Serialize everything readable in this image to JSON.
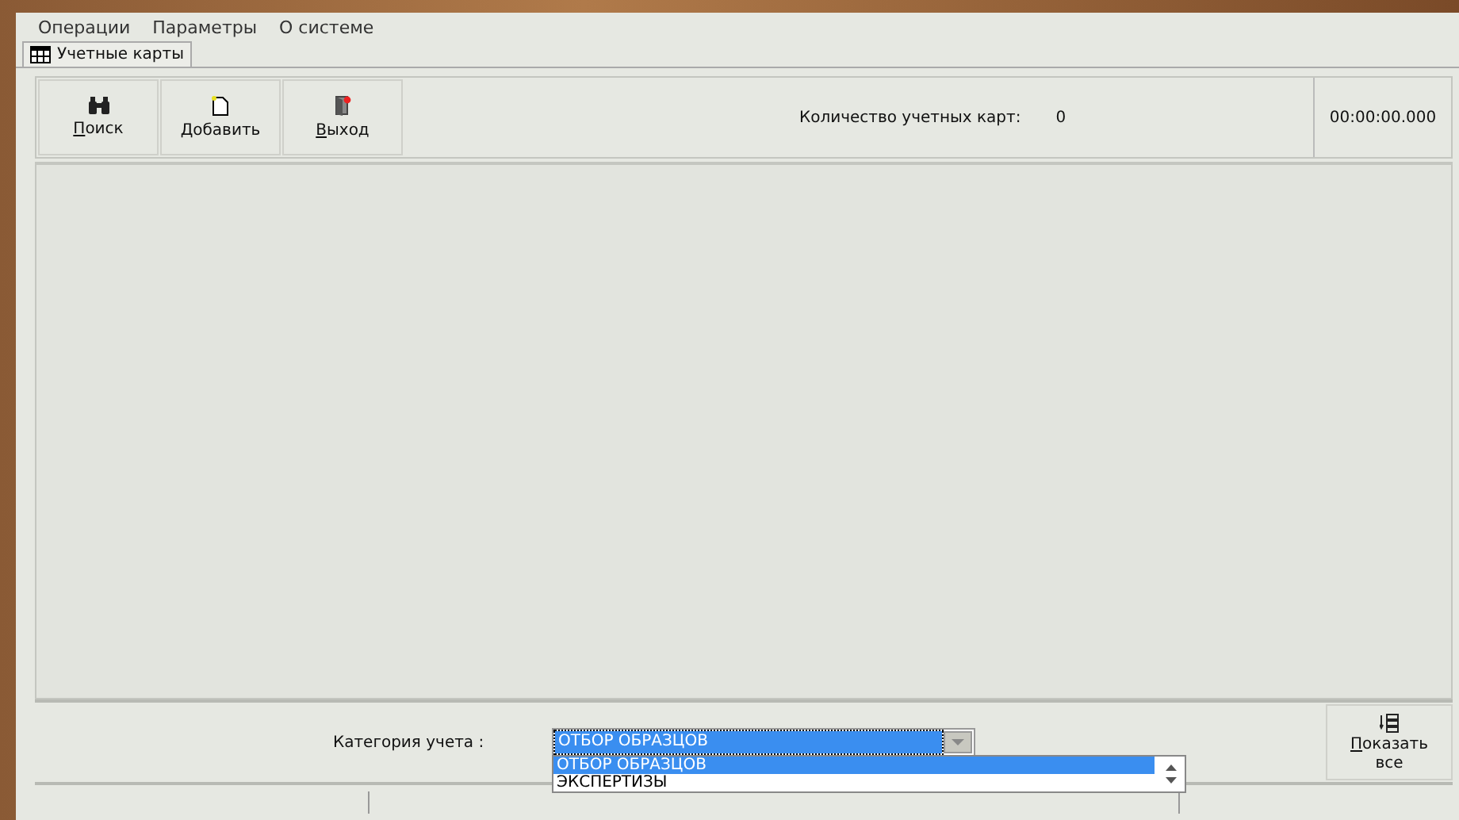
{
  "menu": [
    "Операции",
    "Параметры",
    "О системе"
  ],
  "tabs": [
    {
      "label": "Учетные карты",
      "selected": true
    }
  ],
  "toolbar": [
    {
      "label": "Поиск",
      "kind": "search"
    },
    {
      "label": "Добавить",
      "kind": "add"
    },
    {
      "label": "Выход",
      "kind": "exit"
    }
  ],
  "count": {
    "label": "Количество учетных карт:",
    "value": "0"
  },
  "timer": "00:00:00.000",
  "category": {
    "label": "Категория учета :",
    "value": "ОТБОР ОБРАЗЦОВ",
    "options": [
      {
        "label": "ОТБОР ОБРАЗЦОВ",
        "selected": true
      },
      {
        "label": "ЭКСПЕРТИЗЫ",
        "selected": false
      }
    ]
  },
  "show_all": {
    "label": "Показать",
    "label2": "все"
  }
}
